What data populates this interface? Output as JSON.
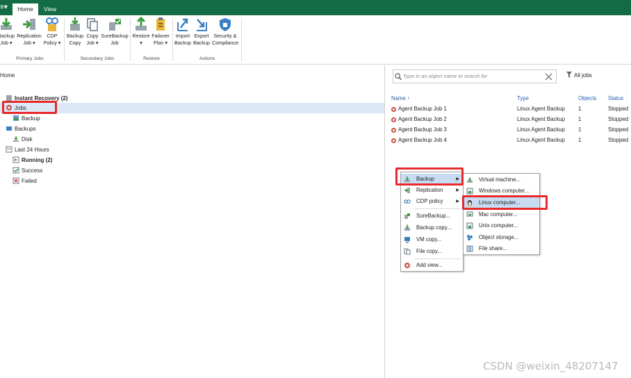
{
  "ribbon": {
    "tabs": [
      "Home",
      "View"
    ],
    "menu_glyph": "≡▾",
    "buttons": [
      {
        "l1": "Backup",
        "l2": "Job ▾"
      },
      {
        "l1": "Replication",
        "l2": "Job ▾"
      },
      {
        "l1": "CDP",
        "l2": "Policy ▾"
      },
      {
        "l1": "Backup",
        "l2": "Copy"
      },
      {
        "l1": "Copy",
        "l2": "Job ▾"
      },
      {
        "l1": "SureBackup",
        "l2": "Job"
      },
      {
        "l1": "Restore",
        "l2": "▾"
      },
      {
        "l1": "Failover",
        "l2": "Plan ▾"
      },
      {
        "l1": "Import",
        "l2": "Backup"
      },
      {
        "l1": "Export",
        "l2": "Backup"
      },
      {
        "l1": "Security &",
        "l2": "Compliance"
      }
    ],
    "groups": [
      "Primary Jobs",
      "Secondary Jobs",
      "Restore",
      "Actions"
    ]
  },
  "left": {
    "breadcrumb": "Home",
    "tree": [
      {
        "label": "Instant Recovery (2)",
        "bold": true
      },
      {
        "label": "Jobs",
        "bold": false
      },
      {
        "label": "Backup",
        "bold": false
      },
      {
        "label": "Backups",
        "bold": false
      },
      {
        "label": "Disk",
        "bold": false
      },
      {
        "label": "Last 24 Hours",
        "bold": false
      },
      {
        "label": "Running (2)",
        "bold": true
      },
      {
        "label": "Success",
        "bold": false
      },
      {
        "label": "Failed",
        "bold": false
      }
    ]
  },
  "right": {
    "search_placeholder": "Type in an object name to search for",
    "filter_label": "All jobs",
    "columns": [
      "Name ↑",
      "Type",
      "Objects",
      "Status"
    ],
    "rows": [
      [
        "Agent Backup Job 1",
        "Linux Agent Backup",
        "1",
        "Stopped"
      ],
      [
        "Agent Backup Job 2",
        "Linux Agent Backup",
        "1",
        "Stopped"
      ],
      [
        "Agent Backup Job 3",
        "Linux Agent Backup",
        "1",
        "Stopped"
      ],
      [
        "Agent Backup Job 4",
        "Linux Agent Backup",
        "1",
        "Stopped"
      ]
    ]
  },
  "context_menu": {
    "items": [
      "Backup",
      "Replication",
      "CDP policy",
      "SureBackup...",
      "Backup copy...",
      "VM copy...",
      "File copy...",
      "Add view..."
    ],
    "submenu": [
      "Virtual machine...",
      "Windows computer...",
      "Linux computer...",
      "Mac computer...",
      "Unix computer...",
      "Object storage...",
      "File share..."
    ]
  },
  "watermark": "CSDN @weixin_48207147",
  "colors": {
    "titlebar": "#136c45",
    "selection": "#dce8f6",
    "highlight_box": "#e8282b",
    "menu_highlight": "#c7dcf3"
  }
}
